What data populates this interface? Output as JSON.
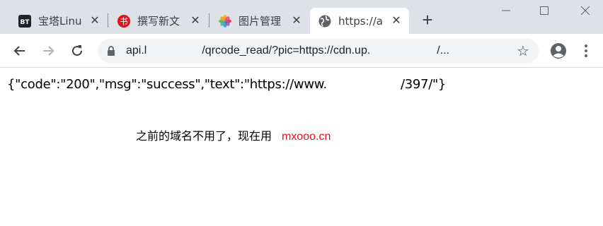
{
  "tabs": [
    {
      "title": "宝塔Linu",
      "icon": "bt-panel-icon"
    },
    {
      "title": "撰写新文",
      "icon": "red-book-icon"
    },
    {
      "title": "图片管理",
      "icon": "photos-flower-icon"
    },
    {
      "title": "https://a",
      "icon": "globe-icon",
      "active": true
    }
  ],
  "toolbar": {
    "url_prefix": "api.l",
    "url_middle": "/qrcode_read/?pic=https://cdn.up.",
    "url_suffix": "/..."
  },
  "page": {
    "json_start": "{\"code\":\"200\",\"msg\":\"success\",\"text\":\"https://www.",
    "json_end": "/397/\"}",
    "note_text": "之前的域名不用了，现在用",
    "note_domain": "mxooo.cn",
    "accent_color": "#e4101c"
  }
}
